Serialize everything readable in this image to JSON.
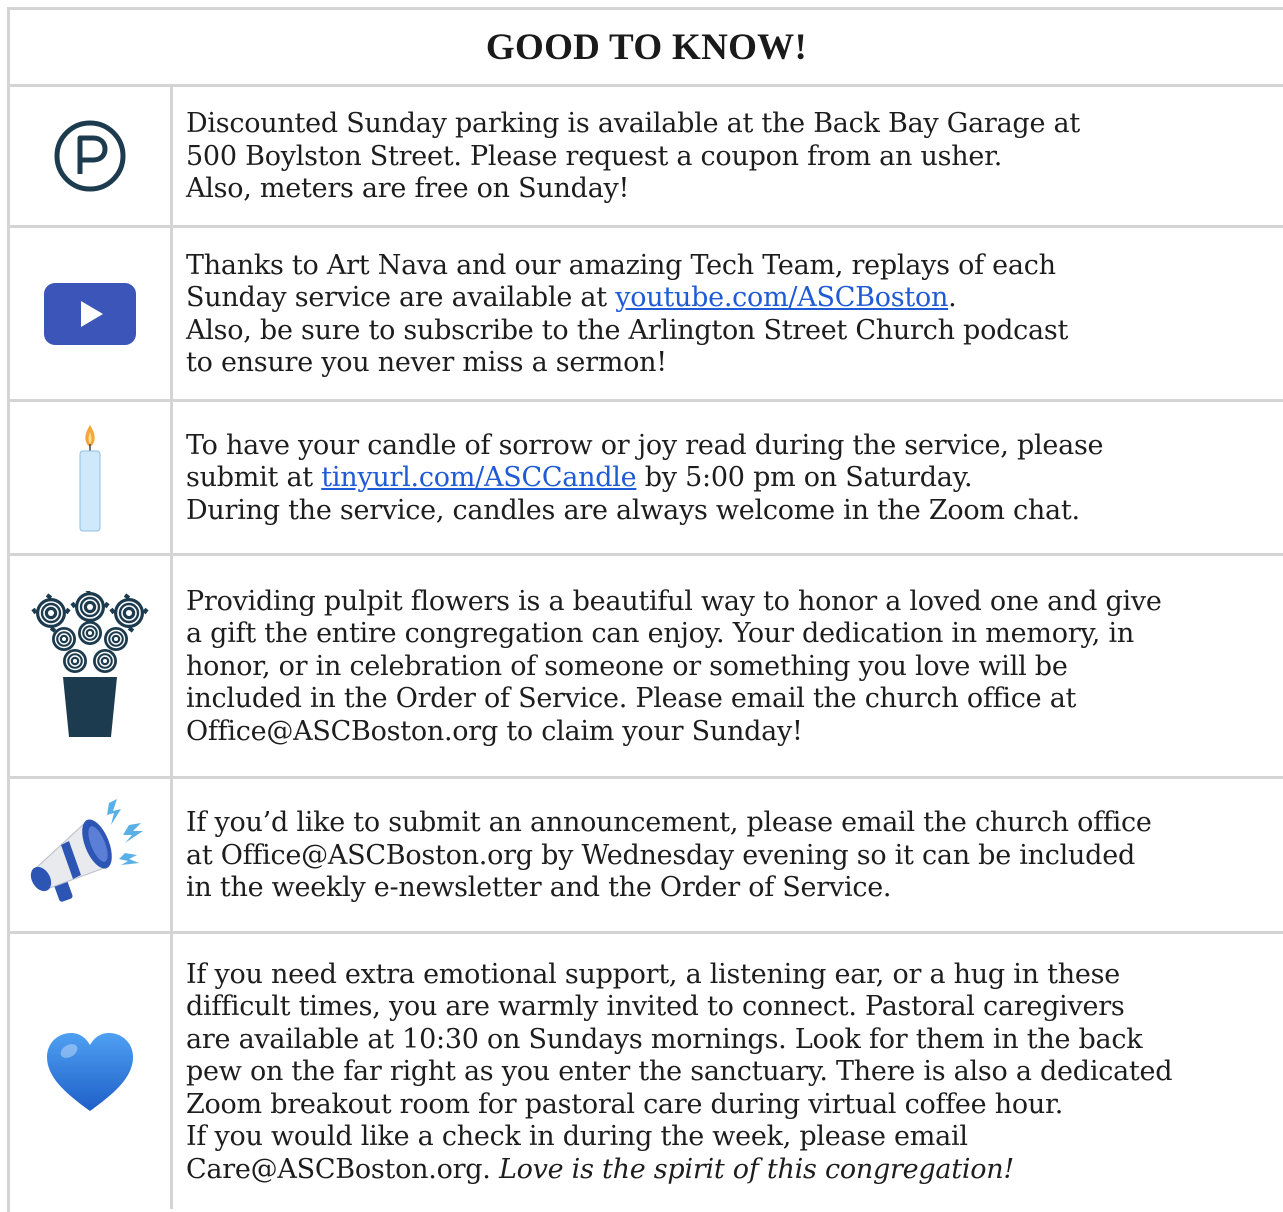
{
  "title": "GOOD TO KNOW!",
  "colors": {
    "border": "#d4d4d4",
    "link": "#1f5bd6",
    "icon_navy": "#1d3b4f",
    "youtube_blue": "#3b55b8",
    "heart_blue": "#2a78e4"
  },
  "rows": [
    {
      "icon": "parking-icon",
      "lines": [
        "Discounted Sunday parking is available at the Back Bay Garage at",
        "500 Boylston Street. Please request a coupon from an usher.",
        "Also, meters are free on Sunday!"
      ]
    },
    {
      "icon": "video-play-icon",
      "line1": "Thanks to Art Nava and our amazing Tech Team, replays of each",
      "line2_pre": "Sunday service are available at ",
      "line2_link": "youtube.com/ASCBoston",
      "line2_post": ".",
      "line3": "Also, be sure to subscribe to the Arlington Street Church podcast",
      "line4": "to ensure you never miss a sermon!"
    },
    {
      "icon": "candle-icon",
      "line1": "To have your candle of sorrow or joy read during the service, please",
      "line2_pre": "submit at ",
      "line2_link": "tinyurl.com/ASCCandle",
      "line2_post": " by 5:00 pm on Saturday.",
      "line3": "During the service, candles are always welcome in the Zoom chat."
    },
    {
      "icon": "flowers-icon",
      "lines": [
        "Providing pulpit flowers is a beautiful way to honor a loved one and give",
        "a gift the entire congregation can enjoy. Your dedication in memory, in",
        "honor, or in celebration of someone or something you love will be",
        "included in the Order of Service. Please email the church office at",
        "Office@ASCBoston.org to claim your Sunday!"
      ]
    },
    {
      "icon": "megaphone-icon",
      "lines": [
        "If you’d like to submit an announcement, please email the church office",
        "at Office@ASCBoston.org by Wednesday evening so it can be included",
        "in the weekly e-newsletter and the Order of Service."
      ]
    },
    {
      "icon": "heart-icon",
      "lines": [
        "If you need extra emotional support, a listening ear, or a hug in these",
        "difficult times, you are warmly invited to connect. Pastoral caregivers",
        "are available at 10:30 on Sundays mornings. Look for them in the back",
        "pew on the far right as you enter the sanctuary. There is also a dedicated",
        "Zoom breakout room for pastoral care during virtual coffee hour.",
        "If you would like a check in during the week, please email"
      ],
      "last_pre": "Care@ASCBoston.org. ",
      "last_italic": "Love is the spirit of this congregation!"
    }
  ]
}
